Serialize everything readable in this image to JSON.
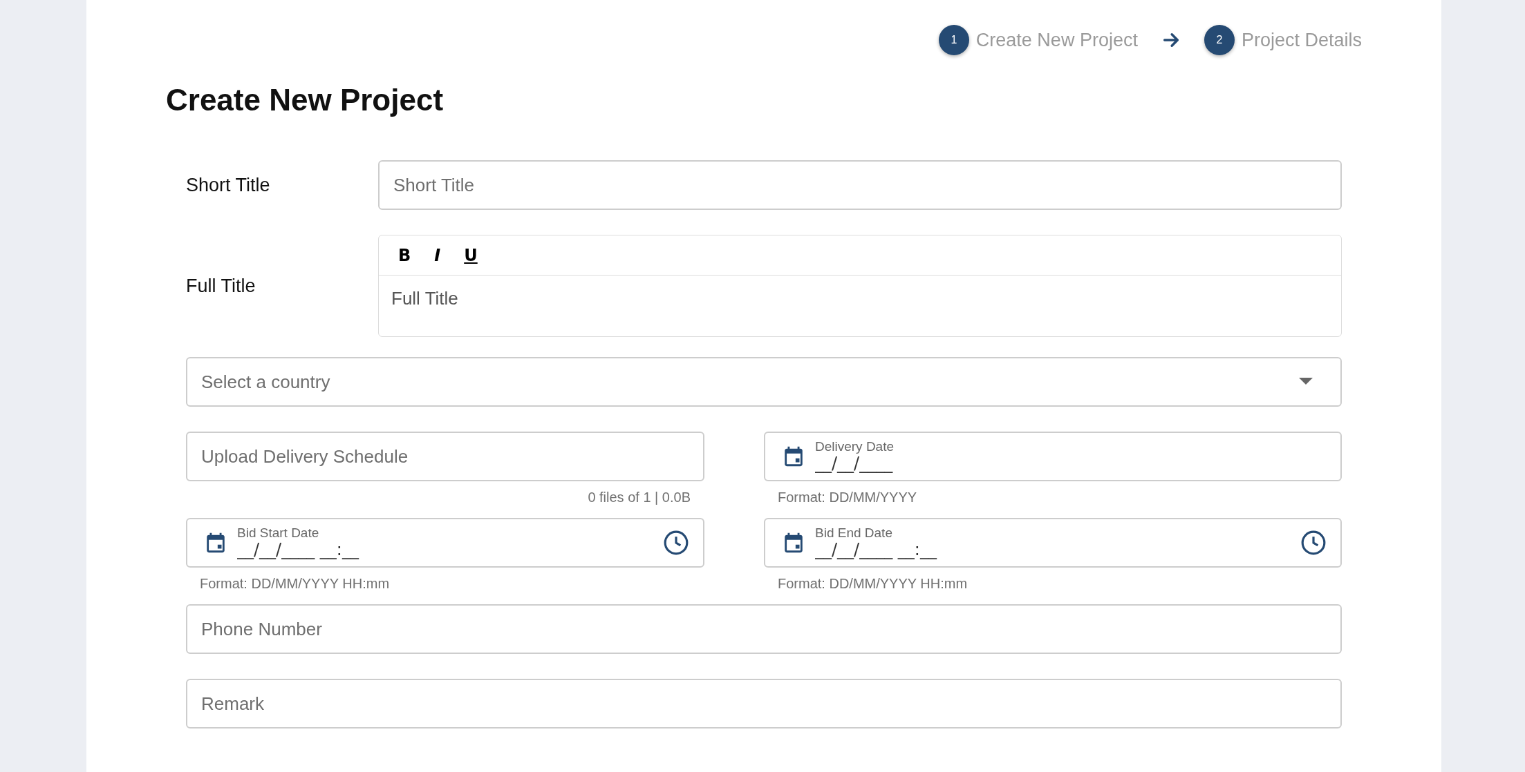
{
  "stepper": {
    "steps": [
      {
        "number": "1",
        "label": "Create New Project"
      },
      {
        "number": "2",
        "label": "Project Details"
      }
    ]
  },
  "heading": "Create New Project",
  "short_title": {
    "label": "Short Title",
    "placeholder": "Short Title"
  },
  "full_title": {
    "label": "Full Title",
    "placeholder": "Full Title",
    "tools": [
      {
        "kind": "bold",
        "glyph": "B"
      },
      {
        "kind": "italic",
        "glyph": "I"
      },
      {
        "kind": "underline",
        "glyph": "U"
      }
    ]
  },
  "country_select": {
    "placeholder": "Select a country"
  },
  "delivery_schedule": {
    "placeholder": "Upload Delivery Schedule",
    "helper": "0 files of 1 | 0.0B"
  },
  "delivery_date": {
    "label": "Delivery Date",
    "value": "__/__/____",
    "helper": "Format: DD/MM/YYYY"
  },
  "bid_start": {
    "label": "Bid Start Date",
    "value": "__/__/____ __:__",
    "helper": "Format: DD/MM/YYYY HH:mm"
  },
  "bid_end": {
    "label": "Bid End Date",
    "value": "__/__/____ __:__",
    "helper": "Format: DD/MM/YYYY HH:mm"
  },
  "phone": {
    "placeholder": "Phone Number"
  },
  "remark": {
    "placeholder": "Remark"
  }
}
